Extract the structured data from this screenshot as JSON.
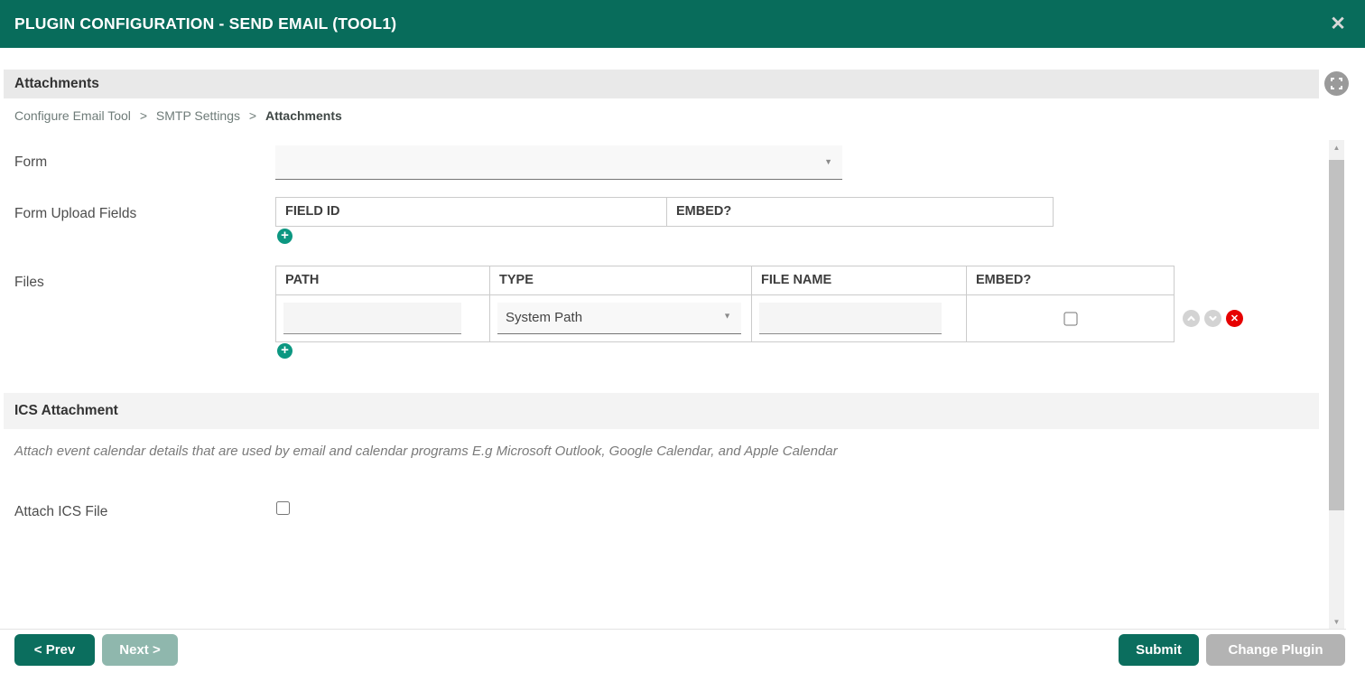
{
  "header": {
    "title": "PLUGIN CONFIGURATION - SEND EMAIL (TOOL1)"
  },
  "icons": {
    "close": "✕",
    "add": "+",
    "delete": "✕",
    "caret_down": "▼",
    "scroll_up": "▲",
    "scroll_down": "▼"
  },
  "attachments_section": {
    "title": "Attachments"
  },
  "breadcrumb": {
    "separator": ">",
    "items": [
      {
        "label": "Configure Email Tool"
      },
      {
        "label": "SMTP Settings"
      },
      {
        "label": "Attachments"
      }
    ]
  },
  "form": {
    "form_label": "Form",
    "form_selected_value": "",
    "upload_fields_label": "Form Upload Fields",
    "upload_fields_headers": [
      "FIELD ID",
      "EMBED?"
    ],
    "files_label": "Files",
    "files_headers": [
      "PATH",
      "TYPE",
      "FILE NAME",
      "EMBED?"
    ],
    "files_row": {
      "path_value": "",
      "type_selected_value": "System Path",
      "file_name_value": "",
      "embed_checked": false
    }
  },
  "ics": {
    "title": "ICS Attachment",
    "description": "Attach event calendar details that are used by email and calendar programs E.g Microsoft Outlook, Google Calendar, and Apple Calendar",
    "attach_label": "Attach ICS File",
    "attach_checked": false
  },
  "footer": {
    "prev_label": "< Prev",
    "next_label": "Next >",
    "submit_label": "Submit",
    "change_plugin_label": "Change Plugin"
  },
  "colors": {
    "header_bg": "#086C5B",
    "primary_button": "#0B6E5E",
    "disabled_button": "#8FB7AD",
    "gray_button": "#B3B3B3",
    "add_icon": "#0C9781",
    "delete_icon": "#E60000"
  }
}
